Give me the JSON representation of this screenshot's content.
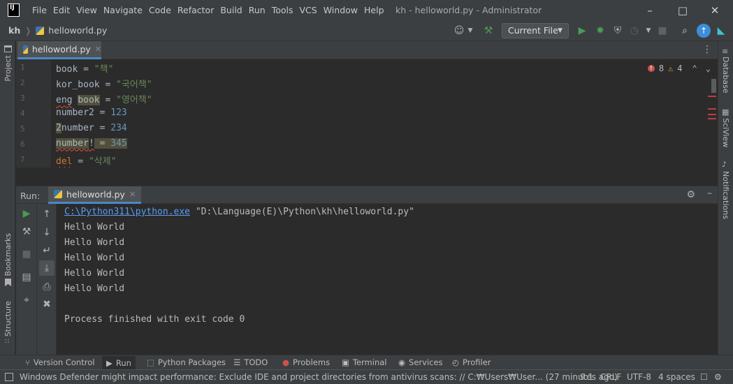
{
  "window": {
    "app_logo": "IJ",
    "title": "kh - helloworld.py - Administrator",
    "menu": [
      "File",
      "Edit",
      "View",
      "Navigate",
      "Code",
      "Refactor",
      "Build",
      "Run",
      "Tools",
      "VCS",
      "Window",
      "Help"
    ]
  },
  "navbar": {
    "project": "kh",
    "file": "helloworld.py",
    "run_config": "Current File"
  },
  "left_strip": {
    "project": "Project",
    "bookmarks": "Bookmarks",
    "structure": "Structure"
  },
  "right_strip": {
    "database": "Database",
    "sciview": "SciView",
    "notifications": "Notifications"
  },
  "editor": {
    "tab": "helloworld.py",
    "errors": "8",
    "warnings": "4",
    "lines": [
      {
        "no": "1"
      },
      {
        "no": "2"
      },
      {
        "no": "3"
      },
      {
        "no": "4"
      },
      {
        "no": "5"
      },
      {
        "no": "6"
      },
      {
        "no": "7"
      }
    ],
    "code": {
      "l1a": "book",
      "l1b": " = ",
      "l1c": "\"책\"",
      "l2a": "kor_book",
      "l2b": " = ",
      "l2c": "\"국어책\"",
      "l3a": "eng",
      "l3b": " ",
      "l3c": "book",
      "l3d": " = ",
      "l3e": "\"영어책\"",
      "l4a": "number2",
      "l4b": " = ",
      "l4c": "123",
      "l5a": "2",
      "l5b": "number",
      "l5c": " = ",
      "l5d": "234",
      "l6a": "number",
      "l6b": "!",
      "l6c": " = ",
      "l6d": "345",
      "l7a": "del",
      "l7b": " = ",
      "l7c": "\"삭제\""
    }
  },
  "run_panel": {
    "label": "Run:",
    "tab": "helloworld.py",
    "console": {
      "exe": "C:\\Python311\\python.exe",
      "script": " \"D:\\Language(E)\\Python\\kh\\helloworld.py\"",
      "out1": "Hello World",
      "out2": "Hello World",
      "out3": "Hello World",
      "out4": "Hello World",
      "out5": "Hello World",
      "finish": "Process finished with exit code 0"
    }
  },
  "bottom_tabs": {
    "version_control": "Version Control",
    "run": "Run",
    "python_packages": "Python Packages",
    "todo": "TODO",
    "problems": "Problems",
    "terminal": "Terminal",
    "services": "Services",
    "profiler": "Profiler"
  },
  "status": {
    "message": "Windows Defender might impact performance: Exclude IDE and project directories from antivirus scans: // C:₩Users₩User... (27 minutes ago)",
    "position": "9:1",
    "line_sep": "CRLF",
    "encoding": "UTF-8",
    "indent": "4 spaces"
  },
  "colors": {
    "accent": "#4a88c7",
    "run_green": "#499c54",
    "error_red": "#bc3f3c",
    "warn_yellow": "#e2a53a"
  }
}
